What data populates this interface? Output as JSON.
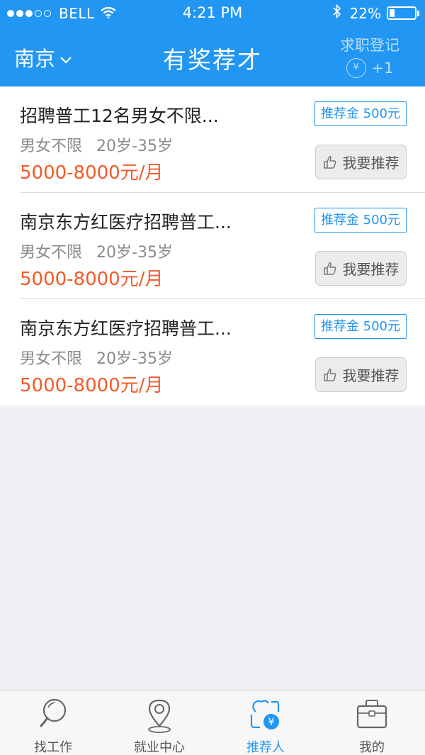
{
  "status_bar": {
    "carrier": "BELL",
    "time": "4:21 PM",
    "battery": "22%",
    "battery_level": 0.22,
    "signal_dots": [
      true,
      true,
      true,
      false,
      false
    ]
  },
  "nav": {
    "city": "南京",
    "title": "有奖荐才",
    "register_label": "求职登记",
    "coin_symbol": "¥",
    "coin_bonus": "+1"
  },
  "jobs": [
    {
      "title": "招聘普工12名男女不限...",
      "gender": "男女不限",
      "age": "20岁-35岁",
      "salary": "5000-8000元/月",
      "bonus": "推荐金 500元",
      "button": "我要推荐"
    },
    {
      "title": "南京东方红医疗招聘普工...",
      "gender": "男女不限",
      "age": "20岁-35岁",
      "salary": "5000-8000元/月",
      "bonus": "推荐金 500元",
      "button": "我要推荐"
    },
    {
      "title": "南京东方红医疗招聘普工...",
      "gender": "男女不限",
      "age": "20岁-35岁",
      "salary": "5000-8000元/月",
      "bonus": "推荐金 500元",
      "button": "我要推荐"
    }
  ],
  "tabs": [
    {
      "label": "找工作",
      "icon": "search-icon",
      "active": false
    },
    {
      "label": "就业中心",
      "icon": "location-pin-icon",
      "active": false
    },
    {
      "label": "推荐人",
      "icon": "referrer-icon",
      "active": true
    },
    {
      "label": "我的",
      "icon": "briefcase-icon",
      "active": false
    }
  ],
  "colors": {
    "primary": "#2196f3",
    "salary": "#f45a26",
    "background": "#efeff4"
  }
}
